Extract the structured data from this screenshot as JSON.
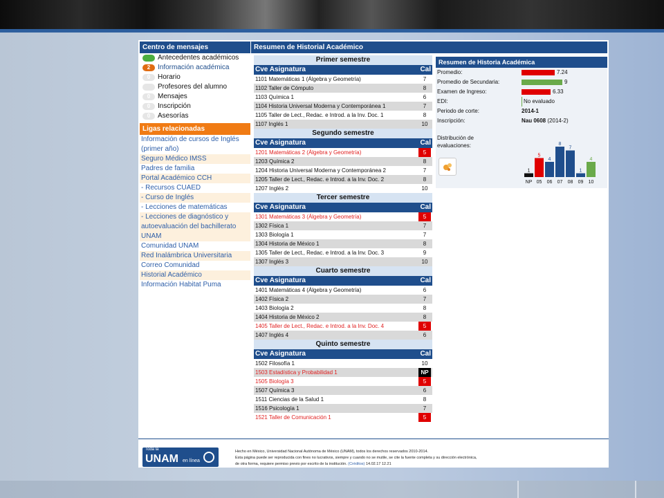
{
  "messages": {
    "header": "Centro de mensajes",
    "items": [
      {
        "badge": "",
        "label": "Antecedentes académicos",
        "style": "green"
      },
      {
        "badge": "2",
        "label": "Información académica",
        "style": "orange"
      },
      {
        "badge": "0",
        "label": "Horario",
        "style": ""
      },
      {
        "badge": "",
        "label": "Profesores del alumno",
        "style": ""
      },
      {
        "badge": "0",
        "label": "Mensajes",
        "style": ""
      },
      {
        "badge": "0",
        "label": "Inscripción",
        "style": ""
      },
      {
        "badge": "0",
        "label": "Asesorías",
        "style": ""
      }
    ]
  },
  "links": {
    "header": "Ligas relacionadas",
    "items": [
      "Información de cursos de Inglés (primer año)",
      "Seguro Médico IMSS",
      "Padres de familia",
      "Portal Académico CCH",
      "- Recursos CUAED",
      "- Curso de Inglés",
      "- Lecciones de matemáticas",
      "- Lecciones de diagnóstico y autoevaluación del bachillerato UNAM",
      "Comunidad UNAM",
      "Red Inalámbrica Universitaria",
      "Correo Comunidad",
      "Historial Académico",
      "Información Habitat Puma"
    ]
  },
  "main": {
    "header": "Resumen de Historial Académico",
    "col_asignatura": "Cve Asignatura",
    "col_cal": "Cal",
    "semesters": [
      {
        "title": "Primer semestre",
        "rows": [
          [
            "1101",
            "Matemáticas 1 (Álgebra y Geometría)",
            "7",
            ""
          ],
          [
            "1102",
            "Taller de Cómputo",
            "8",
            ""
          ],
          [
            "1103",
            "Química 1",
            "6",
            ""
          ],
          [
            "1104",
            "Historia Universal Moderna y Contemporánea 1",
            "7",
            ""
          ],
          [
            "1105",
            "Taller de Lect., Redac. e Introd. a la Inv. Doc. 1",
            "8",
            ""
          ],
          [
            "1107",
            "Inglés 1",
            "10",
            ""
          ]
        ]
      },
      {
        "title": "Segundo semestre",
        "rows": [
          [
            "1201",
            "Matemáticas 2 (Álgebra y Geometría)",
            "5",
            "fail"
          ],
          [
            "1203",
            "Química 2",
            "8",
            ""
          ],
          [
            "1204",
            "Historia Universal Moderna y Contemporánea 2",
            "7",
            ""
          ],
          [
            "1205",
            "Taller de Lect., Redac. e Introd. a la Inv. Doc. 2",
            "8",
            ""
          ],
          [
            "1207",
            "Inglés 2",
            "10",
            ""
          ]
        ]
      },
      {
        "title": "Tercer semestre",
        "rows": [
          [
            "1301",
            "Matemáticas 3 (Álgebra y Geometría)",
            "5",
            "fail"
          ],
          [
            "1302",
            "Física 1",
            "7",
            ""
          ],
          [
            "1303",
            "Biología 1",
            "7",
            ""
          ],
          [
            "1304",
            "Historia de México 1",
            "8",
            ""
          ],
          [
            "1305",
            "Taller de Lect., Redac. e Introd. a la Inv. Doc. 3",
            "9",
            ""
          ],
          [
            "1307",
            "Inglés 3",
            "10",
            ""
          ]
        ]
      },
      {
        "title": "Cuarto semestre",
        "rows": [
          [
            "1401",
            "Matemáticas 4 (Álgebra y Geometría)",
            "6",
            ""
          ],
          [
            "1402",
            "Física 2",
            "7",
            ""
          ],
          [
            "1403",
            "Biología 2",
            "8",
            ""
          ],
          [
            "1404",
            "Historia de México 2",
            "8",
            ""
          ],
          [
            "1405",
            "Taller de Lect., Redac. e Introd. a la Inv. Doc. 4",
            "5",
            "fail"
          ],
          [
            "1407",
            "Inglés 4",
            "6",
            ""
          ]
        ]
      },
      {
        "title": "Quinto semestre",
        "rows": [
          [
            "1502",
            "Filosofía 1",
            "10",
            ""
          ],
          [
            "1503",
            "Estadística y Probabilidad 1",
            "NP",
            "np"
          ],
          [
            "1505",
            "Biología 3",
            "5",
            "fail"
          ],
          [
            "1507",
            "Química 3",
            "6",
            ""
          ],
          [
            "1511",
            "Ciencias de la Salud 1",
            "8",
            ""
          ],
          [
            "1516",
            "Psicología 1",
            "7",
            ""
          ],
          [
            "1521",
            "Taller de Comunicación 1",
            "5",
            "fail"
          ]
        ]
      }
    ]
  },
  "summary": {
    "header": "Resumen de Historia Académica",
    "promedio_label": "Promedio:",
    "promedio": "7.24",
    "promedio_frac": 0.724,
    "secundaria_label": "Promedio de Secundaria:",
    "secundaria": "9",
    "secundaria_frac": 0.9,
    "examen_label": "Examen de Ingreso:",
    "examen": "6.33",
    "examen_frac": 0.633,
    "edi_label": "EDI:",
    "edi": "No evaluado",
    "corte_label": "Periodo de corte:",
    "corte": "2014-1",
    "inscripcion_label": "Inscripción:",
    "inscripcion": "Nau 0608",
    "inscripcion_extra": "(2014-2)",
    "dist_label": "Distribución de evaluaciones:",
    "colors": {
      "red": "#e00000",
      "green": "#6aaa4a",
      "blue": "#1f4e8c",
      "black": "#111111"
    }
  },
  "chart_data": {
    "type": "bar",
    "categories": [
      "NP",
      "05",
      "06",
      "07",
      "08",
      "09",
      "10"
    ],
    "values": [
      1,
      5,
      4,
      8,
      7,
      1,
      4
    ],
    "colors": [
      "#111111",
      "#e00000",
      "#1f4e8c",
      "#1f4e8c",
      "#1f4e8c",
      "#1f4e8c",
      "#6aaa4a"
    ],
    "title": "",
    "xlabel": "",
    "ylabel": ""
  },
  "footer": {
    "logo_small": "Toda la",
    "logo_big": "UNAM",
    "logo_sub": "en línea",
    "line1": "Hecho en México, Universidad Nacional Autónoma de México (UNAM), todos los derechos reservados 2010-2014.",
    "line2": "Esta página puede ser reproducida con fines no lucrativos, siempre y cuando no se mutile, se cite la fuente completa y su dirección electrónica,",
    "line3_a": "de otra forma, requiere permiso previo por escrito de la institución.",
    "line3_link": "(Créditos)",
    "line3_b": "14.02.17 12.21"
  }
}
